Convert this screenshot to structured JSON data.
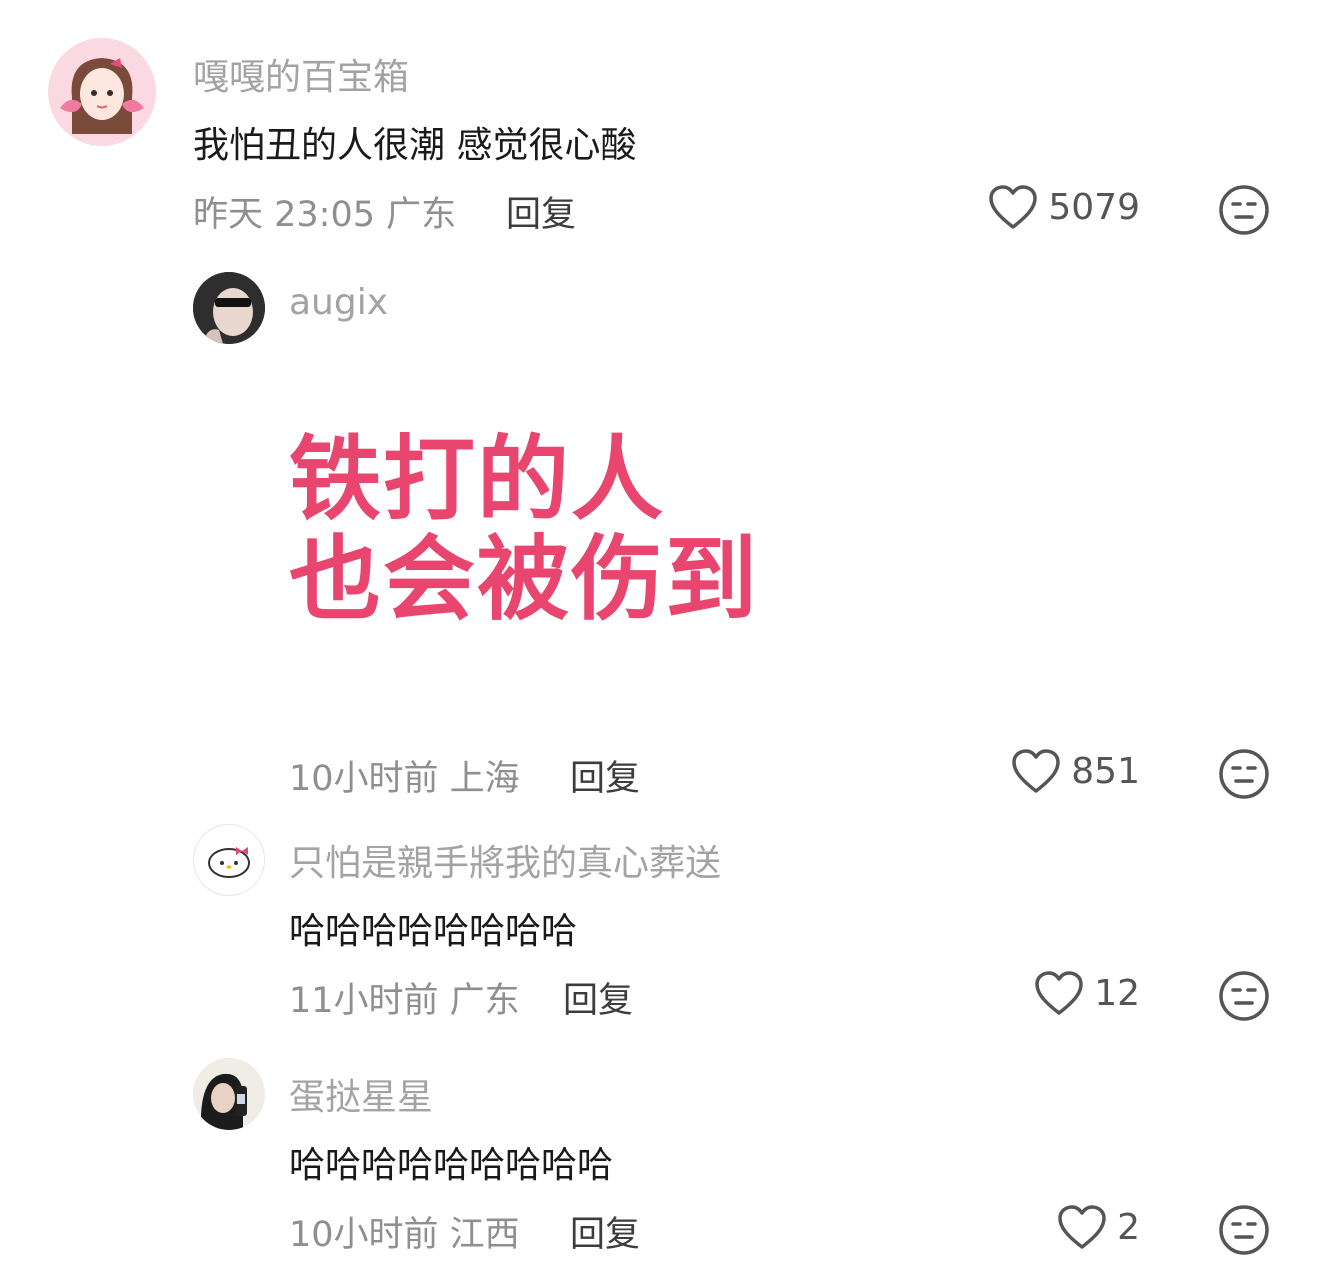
{
  "comments": [
    {
      "username": "嘎嘎的百宝箱",
      "text": "我怕丑的人很潮 感觉很心酸",
      "time_location": "昨天 23:05 广东",
      "reply_label": "回复",
      "likes": "5079"
    },
    {
      "username": "augix",
      "image_text": [
        "铁打的人",
        "也会被伤到"
      ],
      "time_location": "10小时前 上海",
      "reply_label": "回复",
      "likes": "851"
    },
    {
      "username": "只怕是親手將我的真心葬送",
      "text": "哈哈哈哈哈哈哈哈",
      "time_location": "11小时前 广东",
      "reply_label": "回复",
      "likes": "12"
    },
    {
      "username": "蛋挞星星",
      "text": "哈哈哈哈哈哈哈哈哈",
      "time_location": "10小时前 江西",
      "reply_label": "回复",
      "likes": "2"
    }
  ],
  "icons": {
    "like": "heart-outline-icon",
    "dislike": "meh-face-icon"
  },
  "colors": {
    "meme_text": "#e8456f",
    "username": "#a3a3a3",
    "meta": "#8f8f8f"
  }
}
